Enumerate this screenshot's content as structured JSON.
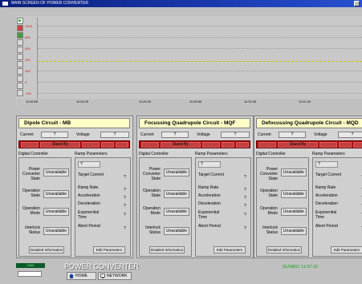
{
  "window": {
    "title": "MAIN SCREEN OF POWER CONVERTER"
  },
  "chart": {
    "y_labels": [
      "1000",
      "800",
      "600",
      "400",
      "200",
      "0",
      "-200"
    ],
    "x_labels": [
      "11:00:00",
      "11:00:20",
      "11:00:40",
      "11:00:60",
      "11:01:00",
      "11:01:20"
    ],
    "trace_color": "#c8c800"
  },
  "panels": [
    {
      "title": "Dipole Circuit - MB",
      "current_label": "Current",
      "current_value": "?",
      "voltage_label": "Voltage",
      "voltage_value": "?",
      "standby": "Stand By",
      "digital_controller": "Digital Controller",
      "ramp_parameters": "Ramp Parameters",
      "states": [
        {
          "label": "Power Converter State",
          "value": "Unavailable"
        },
        {
          "label": "Operation State",
          "value": "Unavailable"
        },
        {
          "label": "Operation Mode",
          "value": "Unavailable"
        },
        {
          "label": "Interlock Status",
          "value": "Unavailable"
        }
      ],
      "ramp_top": "?",
      "ramp": [
        {
          "label": "Target Current",
          "value": "?"
        },
        {
          "label": "Ramp Rate",
          "value": "?"
        },
        {
          "label": "Acceleration",
          "value": "?"
        },
        {
          "label": "Deceleration",
          "value": "?"
        },
        {
          "label": "Exponential Time",
          "value": "?"
        },
        {
          "label": "Abort Period",
          "value": "?"
        }
      ],
      "detailed_btn": "Detailed Information",
      "edit_btn": "Edit Parameters"
    },
    {
      "title": "Focussing Quadrupole Circuit - MQF",
      "current_label": "Current",
      "current_value": "?",
      "voltage_label": "Voltage",
      "voltage_value": "?",
      "standby": "Stand By",
      "digital_controller": "Digital Controller",
      "ramp_parameters": "Ramp Parameters",
      "states": [
        {
          "label": "Power Converter State",
          "value": "Unavailable"
        },
        {
          "label": "Operation State",
          "value": "Unavailable"
        },
        {
          "label": "Operation Mode",
          "value": "Unavailable"
        },
        {
          "label": "Interlock Status",
          "value": "Unavailable"
        }
      ],
      "ramp_top": "?",
      "ramp": [
        {
          "label": "Target Current",
          "value": "?"
        },
        {
          "label": "Ramp Rate",
          "value": "?"
        },
        {
          "label": "Acceleration",
          "value": "?"
        },
        {
          "label": "Deceleration",
          "value": "?"
        },
        {
          "label": "Exponential Time",
          "value": "?"
        },
        {
          "label": "Abort Period",
          "value": "?"
        }
      ],
      "detailed_btn": "Detailed Information",
      "edit_btn": "Edit Parameters"
    },
    {
      "title": "Defocussing Quadrupole Circuit - MQD",
      "current_label": "Current",
      "current_value": "?",
      "voltage_label": "Voltage",
      "voltage_value": "?",
      "standby": "Stand By",
      "digital_controller": "Digital Controller",
      "ramp_parameters": "Ramp Parameters",
      "states": [
        {
          "label": "Power Converter State",
          "value": "Unavailable"
        },
        {
          "label": "Operation State",
          "value": "Unavailable"
        },
        {
          "label": "Operation Mode",
          "value": "Unavailable"
        },
        {
          "label": "Interlock Status",
          "value": "Unavailable"
        }
      ],
      "ramp_top": "?",
      "ramp": [
        {
          "label": "Target Current",
          "value": "?"
        },
        {
          "label": "Ramp Rate",
          "value": "?"
        },
        {
          "label": "Acceleration",
          "value": "?"
        },
        {
          "label": "Deceleration",
          "value": "?"
        },
        {
          "label": "Exponential Time",
          "value": "?"
        },
        {
          "label": "Abort Period",
          "value": "?"
        }
      ],
      "detailed_btn": "Detailed Information",
      "edit_btn": "Edit Parameters"
    }
  ],
  "footer": {
    "counter": "1000",
    "app_title": "POWER CONVERTER",
    "home_btn": "HOME",
    "network_btn": "NETWORK",
    "datetime": "01/08/01 11:37:12",
    "datetime_color": "#10a010"
  }
}
